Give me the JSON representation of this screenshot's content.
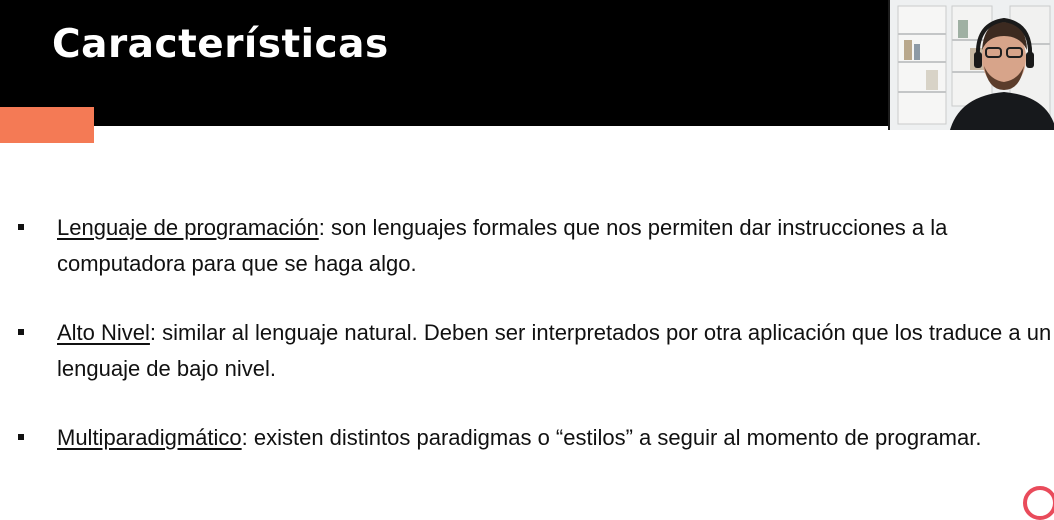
{
  "slide": {
    "title": "Características",
    "items": [
      {
        "term": "Lenguaje de programación",
        "text": ": son lenguajes formales que nos permiten dar instrucciones a la computadora para que se haga algo."
      },
      {
        "term": "Alto Nivel",
        "text": ": similar al lenguaje natural. Deben ser interpretados por otra aplicación que los traduce a un lenguaje de bajo nivel."
      },
      {
        "term": "Multiparadigmático",
        "text": ": existen distintos paradigmas o “estilos” a seguir al momento de programar."
      }
    ]
  },
  "colors": {
    "header": "#000000",
    "title_text": "#ffffff",
    "accent": "#f47a55",
    "corner_ring": "#e94b5b"
  },
  "icons": {
    "bullet": "square-bullet-icon",
    "webcam": "presenter-webcam-feed",
    "corner": "ring-logo-icon"
  }
}
